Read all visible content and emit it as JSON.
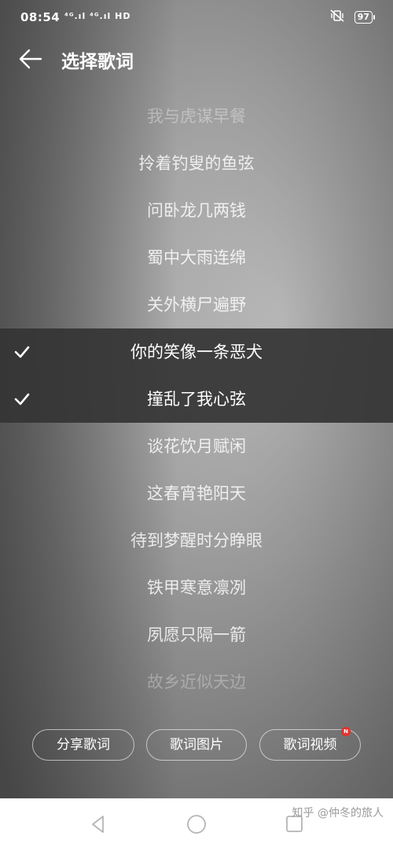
{
  "status_bar": {
    "time": "08:54",
    "signal": "⁴ᴳ.ıl ⁴ᴳ.ıl HD",
    "battery": "97"
  },
  "header": {
    "title": "选择歌词"
  },
  "lyrics": [
    {
      "text": "我与虎谋早餐",
      "selected": false
    },
    {
      "text": "拎着钓叟的鱼弦",
      "selected": false
    },
    {
      "text": "问卧龙几两钱",
      "selected": false
    },
    {
      "text": "蜀中大雨连绵",
      "selected": false
    },
    {
      "text": "关外横尸遍野",
      "selected": false
    },
    {
      "text": "你的笑像一条恶犬",
      "selected": true
    },
    {
      "text": "撞乱了我心弦",
      "selected": true
    },
    {
      "text": "谈花饮月赋闲",
      "selected": false
    },
    {
      "text": "这春宵艳阳天",
      "selected": false
    },
    {
      "text": "待到梦醒时分睁眼",
      "selected": false
    },
    {
      "text": "铁甲寒意凛冽",
      "selected": false
    },
    {
      "text": "夙愿只隔一箭",
      "selected": false
    },
    {
      "text": "故乡近似天边",
      "selected": false
    }
  ],
  "actions": {
    "share_lyrics": "分享歌词",
    "lyrics_image": "歌词图片",
    "lyrics_video": "歌词视频",
    "lyrics_video_badge": "N"
  },
  "watermark": "知乎 @仲冬的旅人",
  "colors": {
    "selected_row": "#343434",
    "badge": "#e5312c"
  }
}
